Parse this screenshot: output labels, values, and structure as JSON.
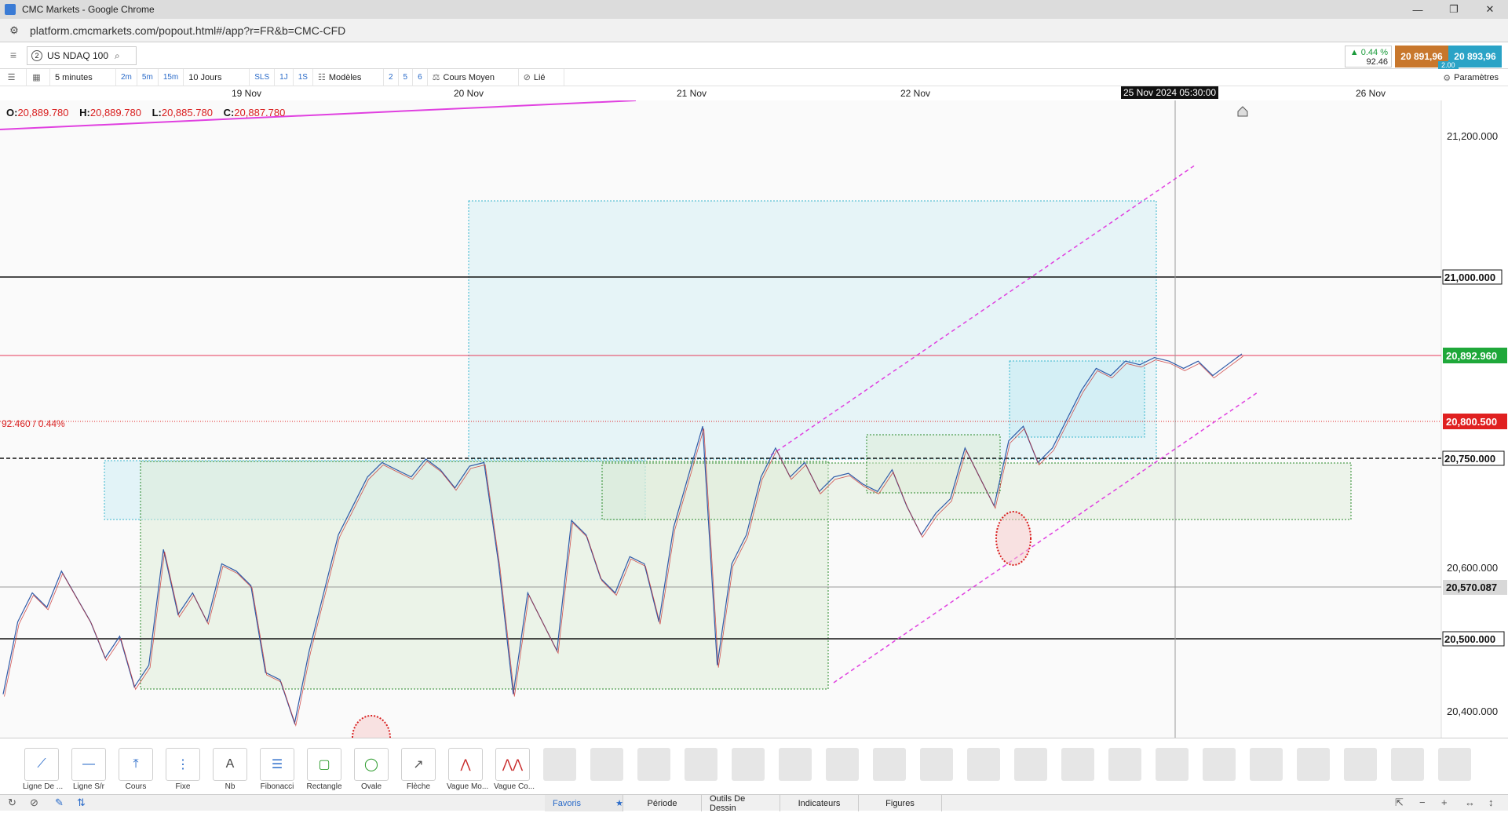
{
  "window": {
    "title": "CMC Markets - Google Chrome",
    "controls": [
      "—",
      "❐",
      "✕"
    ]
  },
  "browser": {
    "url": "platform.cmcmarkets.com/popout.html#/app?r=FR&b=CMC-CFD"
  },
  "header": {
    "instrument_number": "2",
    "instrument": "US NDAQ 100",
    "change_pct": "▲ 0.44 %",
    "change_pts": "92.46",
    "sell_price": "20 891,96",
    "buy_price": "20 893,96",
    "spread": "2.00"
  },
  "toolbar": {
    "interval": "5 minutes",
    "quick_intervals": [
      "2m",
      "5m",
      "15m"
    ],
    "range": "10 Jours",
    "quick_ranges": [
      "SLS",
      "1J",
      "1S"
    ],
    "templates": "Modèles",
    "counts": [
      "2",
      "5",
      "6"
    ],
    "price_type": "Cours Moyen",
    "linked": "Lié",
    "settings": "Paramètres"
  },
  "dates": [
    "19 Nov",
    "20 Nov",
    "21 Nov",
    "22 Nov",
    "26 Nov"
  ],
  "crosshair_date": "25 Nov 2024 05:30:00",
  "ohlc": {
    "o_label": "O:",
    "o": "20,889.780",
    "h_label": "H:",
    "h": "20,889.780",
    "l_label": "L:",
    "l": "20,885.780",
    "c_label": "C:",
    "c": "20,887.780"
  },
  "pct_label": "92.460 / 0.44%",
  "colors": {
    "price_line": "#e53a5a",
    "green_label": "#1fa83a",
    "red_label": "#e02020",
    "channel": "#e040e0",
    "zone_blue": "#bfe9f2",
    "zone_green": "#dcebd6"
  },
  "chart_data": {
    "type": "line",
    "instrument": "US NDAQ 100",
    "interval": "5 minutes",
    "x_ticks": [
      "19 Nov",
      "20 Nov",
      "21 Nov",
      "22 Nov",
      "26 Nov"
    ],
    "y_ticks": [
      "21,200.000",
      "20,600.000",
      "20,400.000"
    ],
    "ylim": [
      20360,
      21240
    ],
    "price_levels": [
      {
        "label": "21,000.000",
        "value": 21000,
        "style": "black"
      },
      {
        "label": "20,892.960",
        "value": 20892.96,
        "style": "green"
      },
      {
        "label": "20,800.500",
        "value": 20800.5,
        "style": "red"
      },
      {
        "label": "20,750.000",
        "value": 20750,
        "style": "black"
      },
      {
        "label": "20,570.087",
        "value": 20570.087,
        "style": "gray"
      },
      {
        "label": "20,500.000",
        "value": 20500,
        "style": "black"
      }
    ],
    "series": [
      {
        "values": [
          20420,
          20520,
          20560,
          20540,
          20590,
          20555,
          20520,
          20470,
          20500,
          20430,
          20460,
          20620,
          20530,
          20560,
          20520,
          20600,
          20590,
          20570,
          20450,
          20440,
          20380,
          20480,
          20560,
          20640,
          20680,
          20720,
          20740,
          20730,
          20720,
          20745,
          20730,
          20705,
          20735,
          20740,
          20600,
          20420,
          20560,
          20520,
          20480,
          20660,
          20640,
          20580,
          20560,
          20610,
          20600,
          20520,
          20650,
          20720,
          20790,
          20460,
          20600,
          20640,
          20720,
          20760,
          20720,
          20740,
          20700,
          20720,
          20725,
          20710,
          20700,
          20730,
          20680,
          20640,
          20670,
          20690,
          20760,
          20720,
          20680,
          20770,
          20790,
          20740,
          20760,
          20800,
          20840,
          20870,
          20860,
          20880,
          20875,
          20885,
          20880,
          20870,
          20880,
          20860,
          20875,
          20890
        ]
      }
    ]
  },
  "drawing_tools": [
    "Ligne De ...",
    "Ligne S/r",
    "Cours",
    "Fixe",
    "Nb",
    "Fibonacci",
    "Rectangle",
    "Ovale",
    "Flèche",
    "Vague Mo...",
    "Vague Co..."
  ],
  "tabs": [
    "Favoris",
    "Période",
    "Outils De Dessin",
    "Indicateurs",
    "Figures"
  ]
}
